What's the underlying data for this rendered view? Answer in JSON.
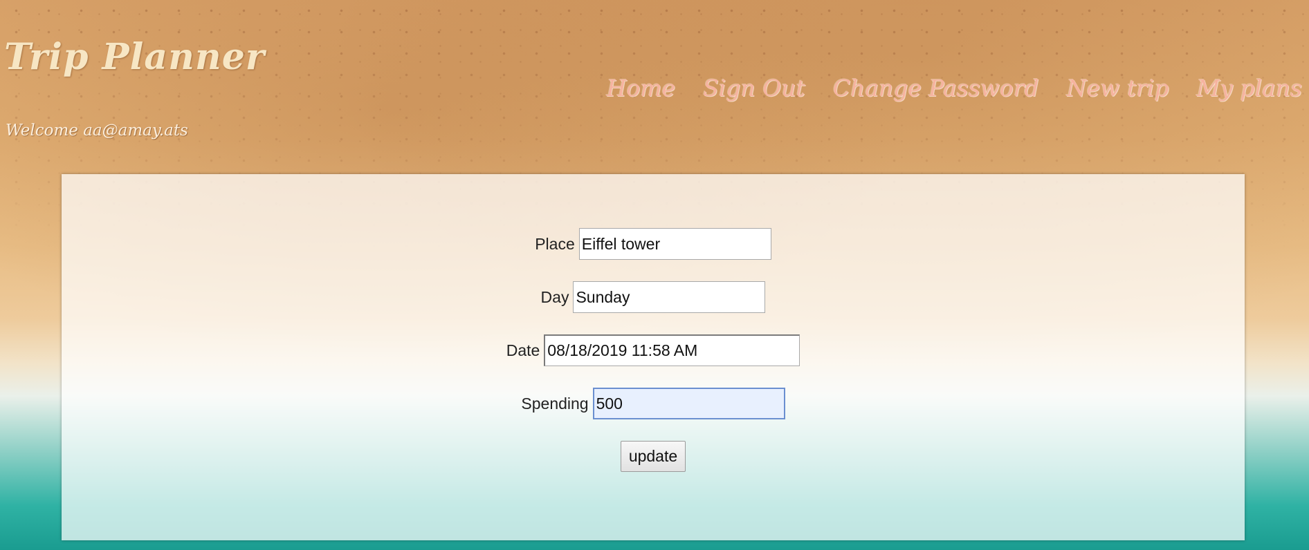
{
  "header": {
    "title": "Trip Planner",
    "welcome_text": "Welcome aa@amay.ats"
  },
  "nav": {
    "items": [
      {
        "label": "Home"
      },
      {
        "label": "Sign Out"
      },
      {
        "label": "Change Password"
      },
      {
        "label": "New trip"
      },
      {
        "label": "My plans"
      }
    ],
    "color": "#f6b3a0"
  },
  "form": {
    "place": {
      "label": "Place",
      "value": "Eiffel tower"
    },
    "day": {
      "label": "Day",
      "value": "Sunday"
    },
    "date": {
      "label": "Date",
      "value": "08/18/2019 11:58 AM"
    },
    "spending": {
      "label": "Spending",
      "value": "500"
    },
    "submit_label": "update"
  },
  "colors": {
    "title": "#f7e6c4",
    "focused_input_border": "#6a8fd0",
    "focused_input_bg": "#e8f0fe"
  }
}
